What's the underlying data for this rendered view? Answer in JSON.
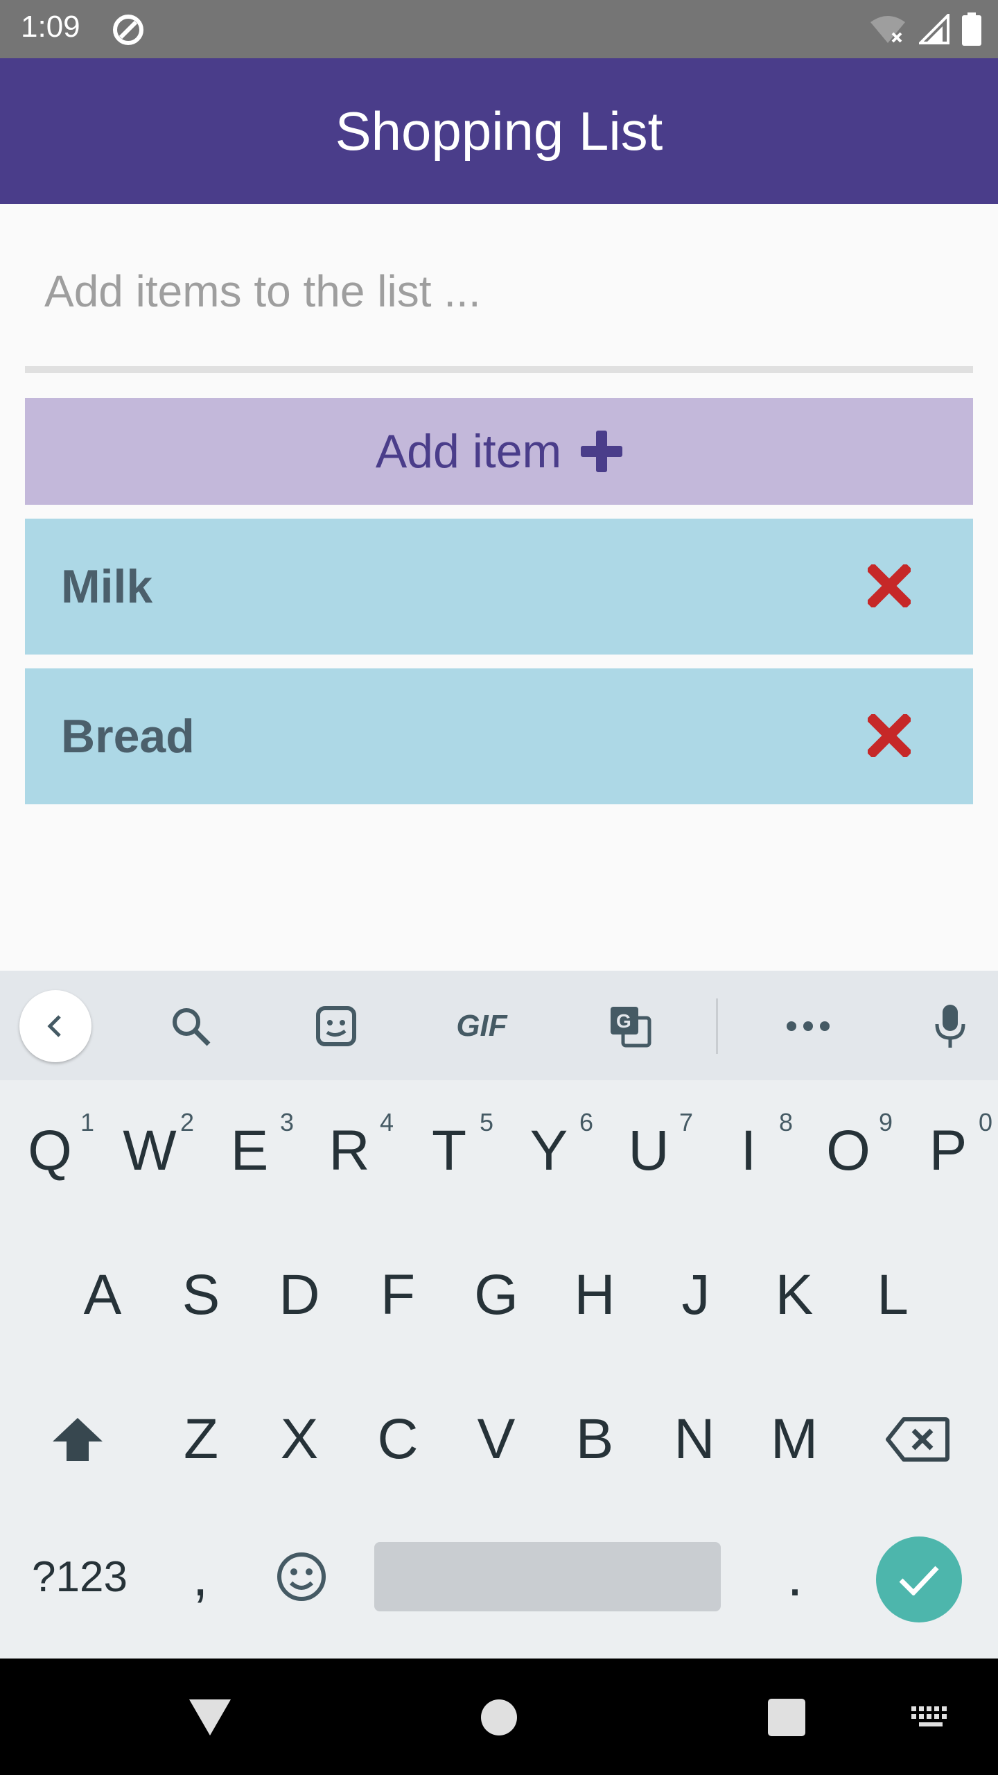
{
  "status_bar": {
    "time": "1:09"
  },
  "app_bar": {
    "title": "Shopping List"
  },
  "input": {
    "placeholder": "Add items to the list ...",
    "value": ""
  },
  "add_button": {
    "label": "Add item"
  },
  "items": [
    {
      "name": "Milk"
    },
    {
      "name": "Bread"
    }
  ],
  "keyboard": {
    "suggestions": {
      "gif_label": "GIF"
    },
    "row1": [
      {
        "key": "Q",
        "hint": "1"
      },
      {
        "key": "W",
        "hint": "2"
      },
      {
        "key": "E",
        "hint": "3"
      },
      {
        "key": "R",
        "hint": "4"
      },
      {
        "key": "T",
        "hint": "5"
      },
      {
        "key": "Y",
        "hint": "6"
      },
      {
        "key": "U",
        "hint": "7"
      },
      {
        "key": "I",
        "hint": "8"
      },
      {
        "key": "O",
        "hint": "9"
      },
      {
        "key": "P",
        "hint": "0"
      }
    ],
    "row2": [
      "A",
      "S",
      "D",
      "F",
      "G",
      "H",
      "J",
      "K",
      "L"
    ],
    "row3": [
      "Z",
      "X",
      "C",
      "V",
      "B",
      "N",
      "M"
    ],
    "symbols_label": "?123",
    "comma_label": ",",
    "period_label": "."
  },
  "colors": {
    "app_bar": "#4a3d8a",
    "add_button": "#c3b8da",
    "list_item": "#add8e6",
    "remove": "#c62828",
    "enter": "#4db6ac"
  }
}
